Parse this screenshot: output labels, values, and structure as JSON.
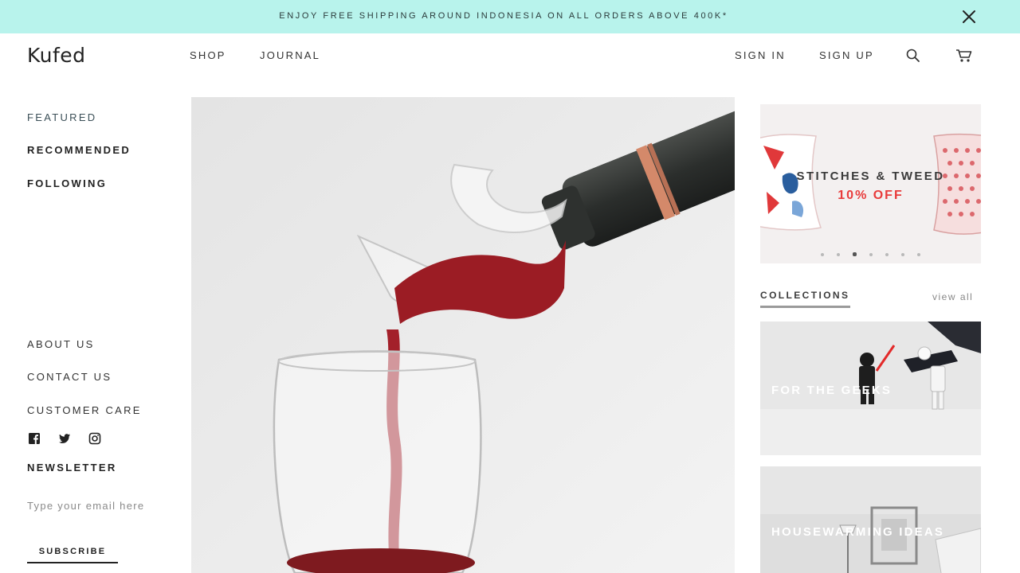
{
  "announcement": {
    "text": "ENJOY FREE SHIPPING AROUND INDONESIA ON ALL ORDERS ABOVE 400K*"
  },
  "header": {
    "logo": "Kufed",
    "nav": {
      "shop": "SHOP",
      "journal": "JOURNAL"
    },
    "account": {
      "sign_in": "SIGN IN",
      "sign_up": "SIGN UP"
    },
    "icons": {
      "search": "search-icon",
      "cart": "cart-icon",
      "close": "close-icon"
    }
  },
  "sidebar": {
    "primary": [
      {
        "label": "FEATURED"
      },
      {
        "label": "RECOMMENDED"
      },
      {
        "label": "FOLLOWING"
      }
    ],
    "secondary": [
      {
        "label": "ABOUT US"
      },
      {
        "label": "CONTACT US"
      },
      {
        "label": "CUSTOMER CARE"
      }
    ],
    "social": [
      "facebook-icon",
      "twitter-icon",
      "instagram-icon"
    ],
    "newsletter": {
      "heading": "NEWSLETTER",
      "placeholder": "Type your email here",
      "button": "SUBSCRIBE"
    }
  },
  "promo": {
    "title": "STITCHES & TWEED",
    "subtitle": "10% OFF",
    "slide_count": 7,
    "active_slide": 3
  },
  "collections": {
    "heading": "COLLECTIONS",
    "view_all": "view all",
    "cards": [
      {
        "label": "FOR THE GEEKS"
      },
      {
        "label": "HOUSEWARMING IDEAS"
      }
    ]
  },
  "colors": {
    "announcement_bg": "#b8f3ec",
    "promo_accent": "#e83b3b",
    "wine": "#9b1c24"
  }
}
